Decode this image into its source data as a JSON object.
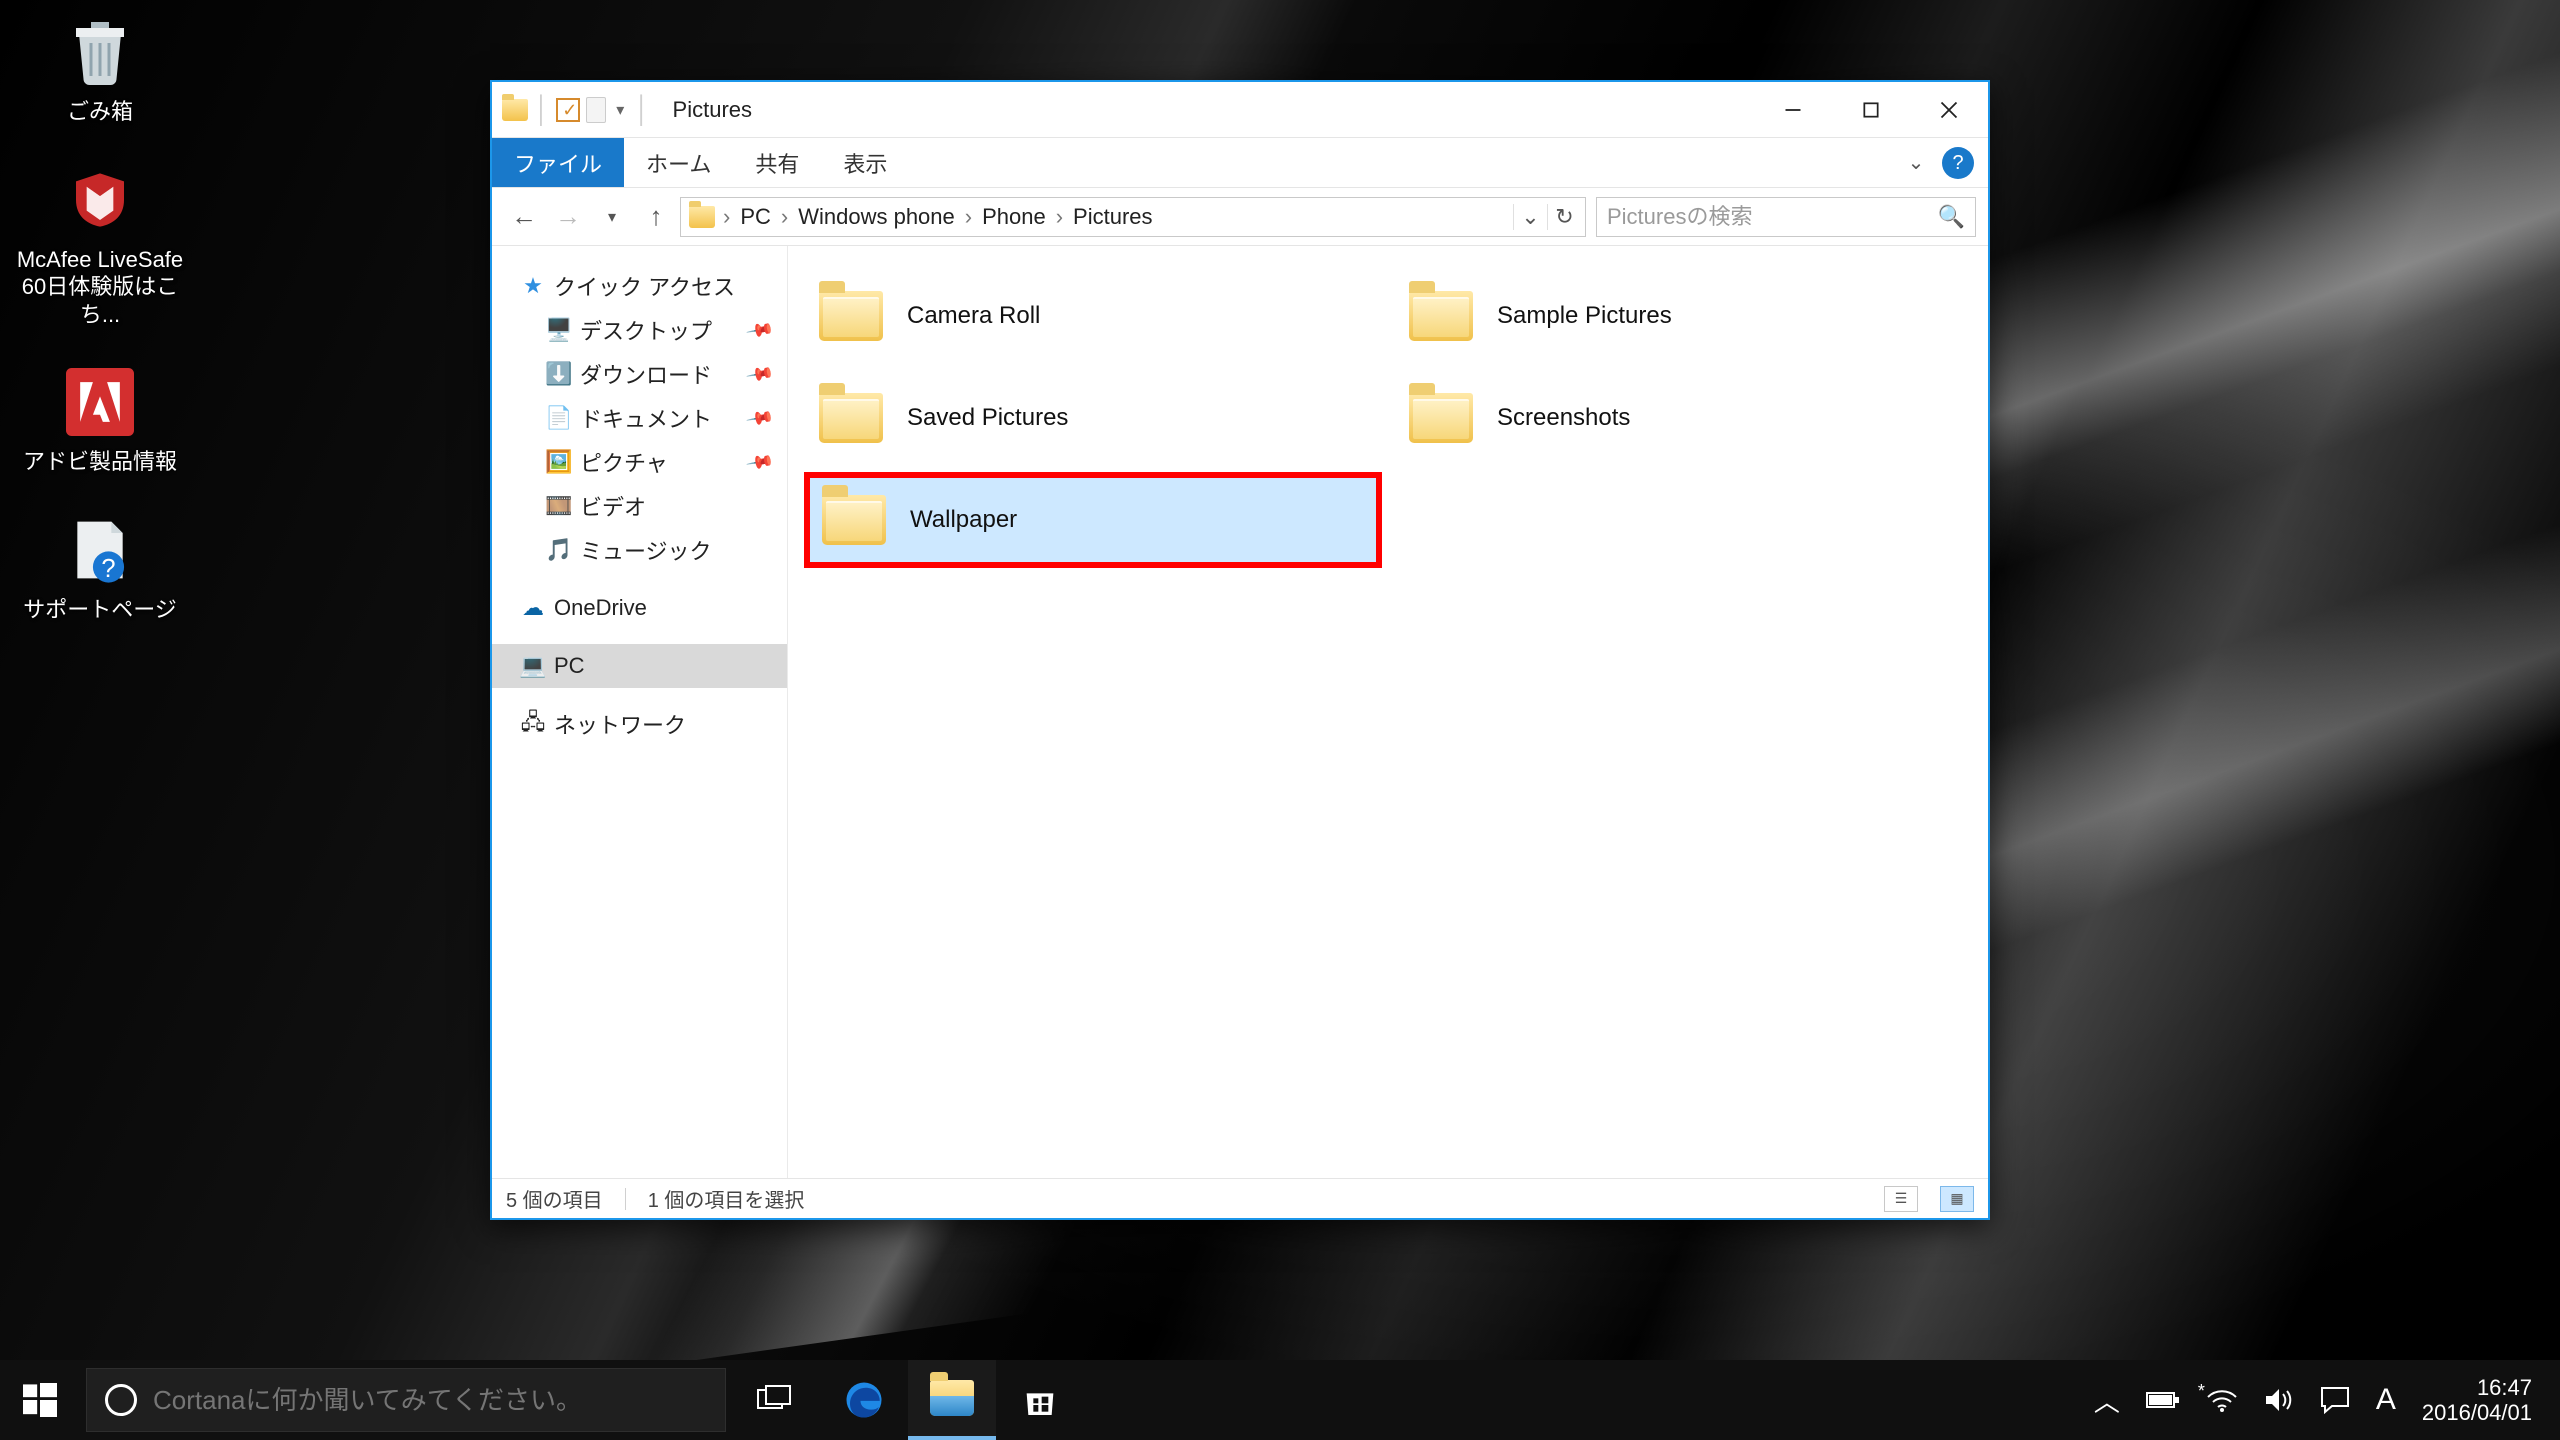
{
  "desktop": {
    "icons": [
      {
        "name": "recycle-bin",
        "label": "ごみ箱"
      },
      {
        "name": "mcafee",
        "label": "McAfee LiveSafe\n60日体験版はこち..."
      },
      {
        "name": "adobe",
        "label": "アドビ製品情報"
      },
      {
        "name": "support",
        "label": "サポートページ"
      }
    ]
  },
  "explorer": {
    "title": "Pictures",
    "tabs": {
      "file": "ファイル",
      "home": "ホーム",
      "share": "共有",
      "view": "表示"
    },
    "breadcrumb": [
      "PC",
      "Windows phone",
      "Phone",
      "Pictures"
    ],
    "search_placeholder": "Picturesの検索",
    "nav": {
      "quick_access": "クイック アクセス",
      "quick_children": [
        "デスクトップ",
        "ダウンロード",
        "ドキュメント",
        "ピクチャ",
        "ビデオ",
        "ミュージック"
      ],
      "onedrive": "OneDrive",
      "pc": "PC",
      "network": "ネットワーク"
    },
    "folders": [
      {
        "label": "Camera Roll",
        "selected": false,
        "highlight": false
      },
      {
        "label": "Sample Pictures",
        "selected": false,
        "highlight": false
      },
      {
        "label": "Saved Pictures",
        "selected": false,
        "highlight": false
      },
      {
        "label": "Screenshots",
        "selected": false,
        "highlight": false
      },
      {
        "label": "Wallpaper",
        "selected": true,
        "highlight": true
      }
    ],
    "status": {
      "count": "5 個の項目",
      "selected": "1 個の項目を選択"
    }
  },
  "taskbar": {
    "search_placeholder": "Cortanaに何か聞いてみてください。",
    "ime": "A",
    "time": "16:47",
    "date": "2016/04/01"
  }
}
